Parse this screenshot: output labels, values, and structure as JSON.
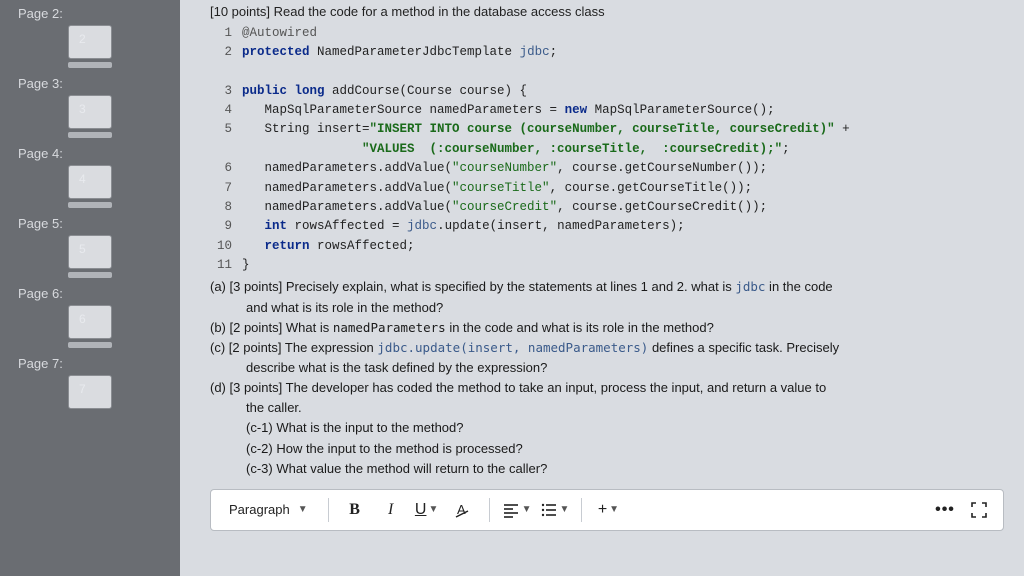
{
  "sidebar": {
    "pages": [
      {
        "label": "Page 2:",
        "num": "2"
      },
      {
        "label": "Page 3:",
        "num": "3"
      },
      {
        "label": "Page 4:",
        "num": "4"
      },
      {
        "label": "Page 5:",
        "num": "5"
      },
      {
        "label": "Page 6:",
        "num": "6"
      },
      {
        "label": "Page 7:",
        "num": "7"
      }
    ]
  },
  "question": {
    "header": "[10 points] Read the code for a method in the database access class",
    "code": {
      "l1": "@Autowired",
      "l2a": "protected",
      "l2b": " NamedParameterJdbcTemplate ",
      "l2c": "jdbc",
      "l2d": ";",
      "l3a": "public long ",
      "l3b": "addCourse(Course course) {",
      "l4a": "   MapSqlParameterSource namedParameters = ",
      "l4b": "new",
      "l4c": " MapSqlParameterSource();",
      "l5a": "   String insert=",
      "l5b": "\"INSERT INTO course (courseNumber, courseTitle, courseCredit)\"",
      "l5c": " +",
      "l5d": "                \"VALUES  (:courseNumber, :courseTitle,  :courseCredit);\"",
      "l5e": ";",
      "l6a": "   namedParameters.addValue(",
      "l6b": "\"courseNumber\"",
      "l6c": ", course.getCourseNumber());",
      "l7a": "   namedParameters.addValue(",
      "l7b": "\"courseTitle\"",
      "l7c": ", course.getCourseTitle());",
      "l8a": "   namedParameters.addValue(",
      "l8b": "\"courseCredit\"",
      "l8c": ", course.getCourseCredit());",
      "l9a": "   int",
      "l9b": " rowsAffected = ",
      "l9c": "jdbc",
      "l9d": ".update(insert, namedParameters);",
      "l10a": "   return",
      "l10b": " rowsAffected;",
      "l11": "}"
    },
    "parts": {
      "a1": "(a) [3 points] Precisely explain, what is specified by the statements at lines 1 and 2. what is ",
      "a_code": "jdbc",
      "a2": " in the code",
      "a3": "and what is its role in the method?",
      "b1": "(b) [2 points] What is ",
      "b_code": "namedParameters",
      "b2": " in the code and what is its role in the method?",
      "c1": "(c) [2 points] The expression ",
      "c_code": "jdbc.update(insert, namedParameters)",
      "c2": " defines a specific task. Precisely",
      "c3": "describe what is the task defined by the expression?",
      "d1": "(d) [3 points] The developer has coded the method to take an input, process the input, and return a value to",
      "d2": "the caller.",
      "d_c1": "(c-1) What is the input to the method?",
      "d_c2": "(c-2) How the input to the method is processed?",
      "d_c3": "(c-3) What value the method will return to the caller?"
    }
  },
  "toolbar": {
    "format": "Paragraph",
    "bold": "B",
    "italic": "I",
    "underline": "U",
    "plus": "+",
    "more": "•••"
  },
  "ln": {
    "n1": "1",
    "n2": "2",
    "n3": "3",
    "n4": "4",
    "n5": "5",
    "n6": "6",
    "n7": "7",
    "n8": "8",
    "n9": "9",
    "n10": "10",
    "n11": "11"
  }
}
